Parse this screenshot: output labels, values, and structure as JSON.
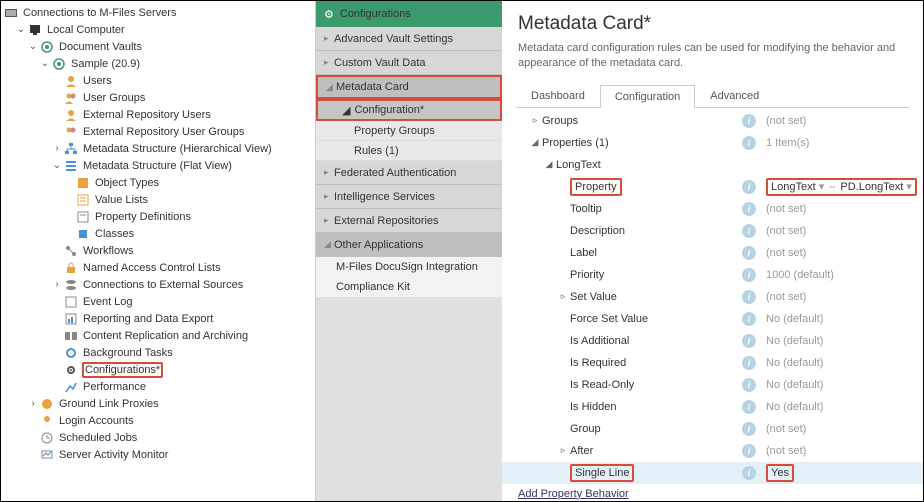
{
  "left": {
    "root": "Connections to M-Files Servers",
    "local": "Local Computer",
    "docvault": "Document Vaults",
    "sample": "Sample (20.9)",
    "users": "Users",
    "usergroups": "User Groups",
    "extrepousers": "External Repository Users",
    "extrepogroups": "External Repository User Groups",
    "metahier": "Metadata Structure (Hierarchical View)",
    "metaflat": "Metadata Structure (Flat View)",
    "objtypes": "Object Types",
    "valuelists": "Value Lists",
    "propdefs": "Property Definitions",
    "classes": "Classes",
    "workflows": "Workflows",
    "nacl": "Named Access Control Lists",
    "connext": "Connections to External Sources",
    "eventlog": "Event Log",
    "report": "Reporting and Data Export",
    "contentrepl": "Content Replication and Archiving",
    "bgtasks": "Background Tasks",
    "configs": "Configurations*",
    "perf": "Performance",
    "glp": "Ground Link Proxies",
    "loginacc": "Login Accounts",
    "schedjobs": "Scheduled Jobs",
    "sam": "Server Activity Monitor"
  },
  "mid": {
    "title": "Configurations",
    "advvault": "Advanced Vault Settings",
    "cvd": "Custom Vault Data",
    "mc": "Metadata Card",
    "config": "Configuration*",
    "propgroups": "Property Groups",
    "rules": "Rules (1)",
    "fedauth": "Federated Authentication",
    "intel": "Intelligence Services",
    "extrepo": "External Repositories",
    "otherapps": "Other Applications",
    "docusign": "M-Files DocuSign Integration",
    "compliance": "Compliance Kit"
  },
  "right": {
    "title": "Metadata Card*",
    "desc": "Metadata card configuration rules can be used for modifying the behavior and appearance of the metadata card.",
    "tabs": {
      "dash": "Dashboard",
      "conf": "Configuration",
      "adv": "Advanced"
    },
    "props": {
      "groups": "Groups",
      "groups_v": "(not set)",
      "properties": "Properties (1)",
      "properties_v": "1 Item(s)",
      "longtext": "LongText",
      "property": "Property",
      "property_v1": "LongText",
      "property_v2": "PD.LongText",
      "tooltip": "Tooltip",
      "tooltip_v": "(not set)",
      "description": "Description",
      "description_v": "(not set)",
      "label": "Label",
      "label_v": "(not set)",
      "priority": "Priority",
      "priority_v": "1000 (default)",
      "setvalue": "Set Value",
      "setvalue_v": "(not set)",
      "forcesv": "Force Set Value",
      "forcesv_v": "No (default)",
      "isadd": "Is Additional",
      "isadd_v": "No (default)",
      "isreq": "Is Required",
      "isreq_v": "No (default)",
      "isro": "Is Read-Only",
      "isro_v": "No (default)",
      "ishid": "Is Hidden",
      "ishid_v": "No (default)",
      "group": "Group",
      "group_v": "(not set)",
      "after": "After",
      "after_v": "(not set)",
      "singleline": "Single Line",
      "singleline_v": "Yes",
      "addprop": "Add Property Behavior"
    }
  }
}
